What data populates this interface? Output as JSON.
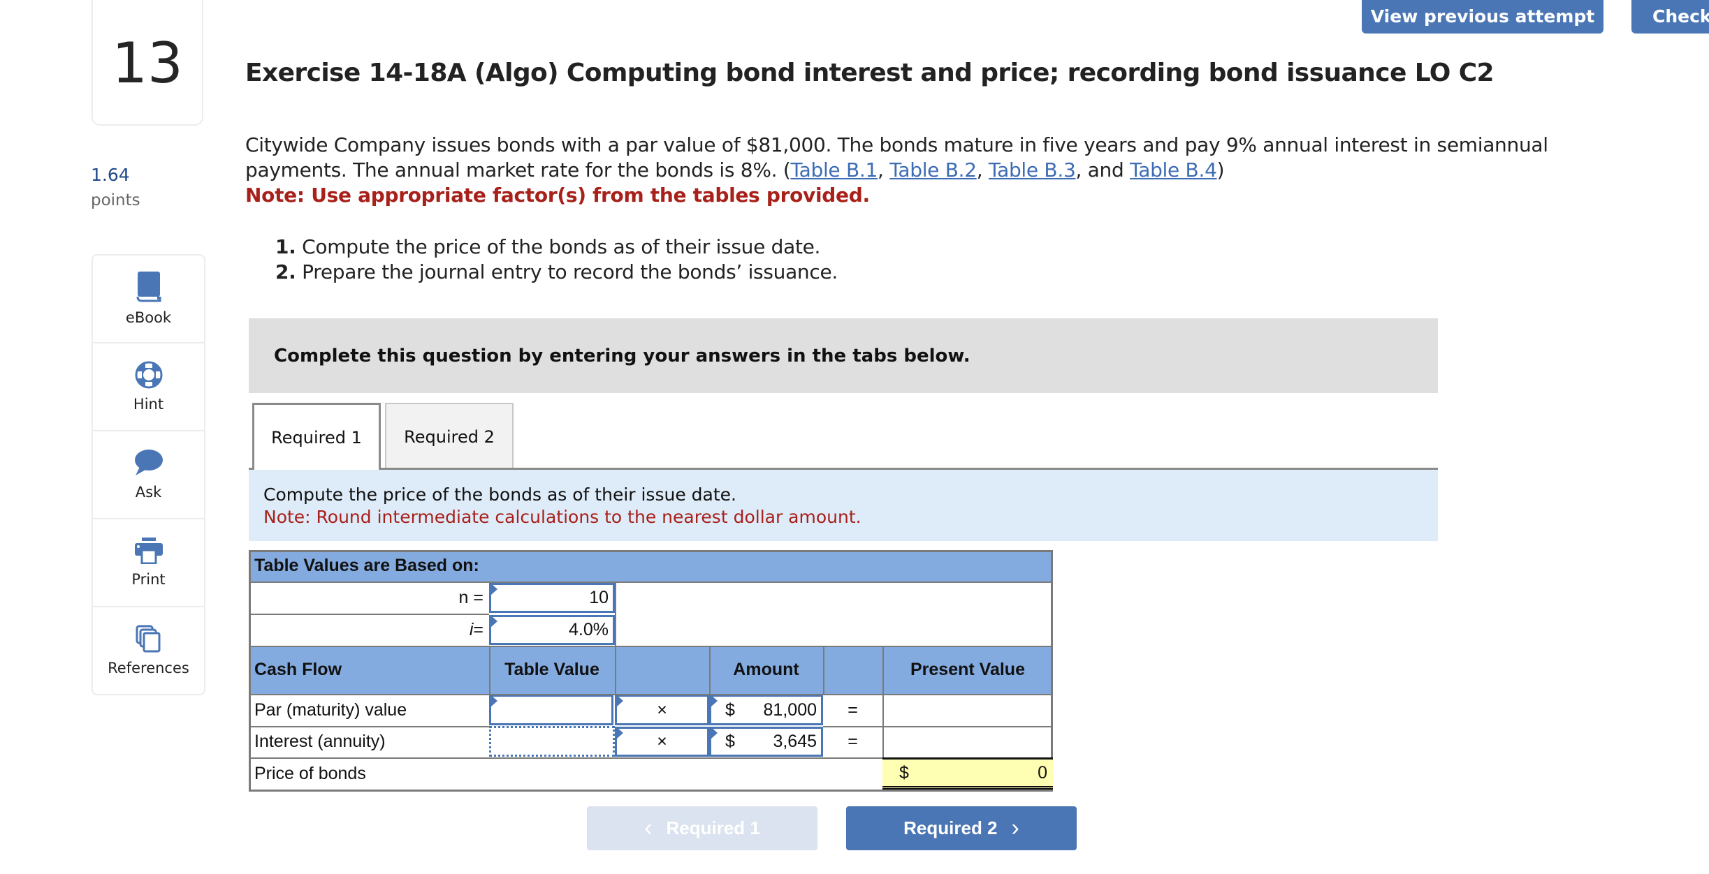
{
  "header": {
    "view_previous_label": "View previous attempt",
    "check_label": "Check"
  },
  "question": {
    "number": "13",
    "points_value": "1.64",
    "points_label": "points",
    "title": "Exercise 14-18A (Algo) Computing bond interest and price; recording bond issuance LO C2",
    "intro_text": "Citywide Company issues bonds with a par value of $81,000. The bonds mature in five years and pay 9% annual interest in semiannual payments. The annual market rate for the bonds is 8%. (",
    "links": [
      "Table B.1",
      "Table B.2",
      "Table B.3",
      "Table B.4"
    ],
    "link_sep_1": ", ",
    "link_sep_2": ", ",
    "link_sep_3": ", and ",
    "intro_close": ")",
    "note": "Note: Use appropriate factor(s) from the tables provided.",
    "requirements": [
      {
        "num": "1.",
        "text": " Compute the price of the bonds as of their issue date."
      },
      {
        "num": "2.",
        "text": " Prepare the journal entry to record the bonds’ issuance."
      }
    ]
  },
  "sidebar": {
    "tools": [
      {
        "label": "eBook",
        "icon": "book-icon"
      },
      {
        "label": "Hint",
        "icon": "lifebuoy-icon"
      },
      {
        "label": "Ask",
        "icon": "speech-bubble-icon"
      },
      {
        "label": "Print",
        "icon": "printer-icon"
      },
      {
        "label": "References",
        "icon": "documents-icon"
      }
    ]
  },
  "instructions_banner": "Complete this question by entering your answers in the tabs below.",
  "tabs": [
    {
      "label": "Required 1",
      "active": true
    },
    {
      "label": "Required 2",
      "active": false
    }
  ],
  "instruction": {
    "text": "Compute the price of the bonds as of their issue date.",
    "note": "Note: Round intermediate calculations to the nearest dollar amount."
  },
  "pv_table": {
    "title": "Table Values are Based on:",
    "n_label": "n =",
    "n_value": "10",
    "i_label": "i",
    "i_eq": " =",
    "i_value": "4.0%",
    "headers": {
      "cash_flow": "Cash Flow",
      "table_value": "Table Value",
      "amount": "Amount",
      "present_value": "Present Value"
    },
    "rows": [
      {
        "label": "Par (maturity) value",
        "table_value": "",
        "operator": "×",
        "currency": "$",
        "amount": "81,000",
        "equals": "=",
        "present_value": ""
      },
      {
        "label": "Interest (annuity)",
        "table_value": "",
        "operator": "×",
        "currency": "$",
        "amount": "3,645",
        "equals": "=",
        "present_value": ""
      }
    ],
    "total": {
      "label": "Price of bonds",
      "currency": "$",
      "value": "0"
    }
  },
  "nav": {
    "prev_label": "Required 1",
    "next_label": "Required 2",
    "prev_arrow": "‹",
    "next_arrow": "›"
  },
  "colors": {
    "primary": "#4a76b5",
    "note_red": "#a8201a",
    "header_blue": "#84abdf",
    "total_yellow": "#ffffb3"
  }
}
